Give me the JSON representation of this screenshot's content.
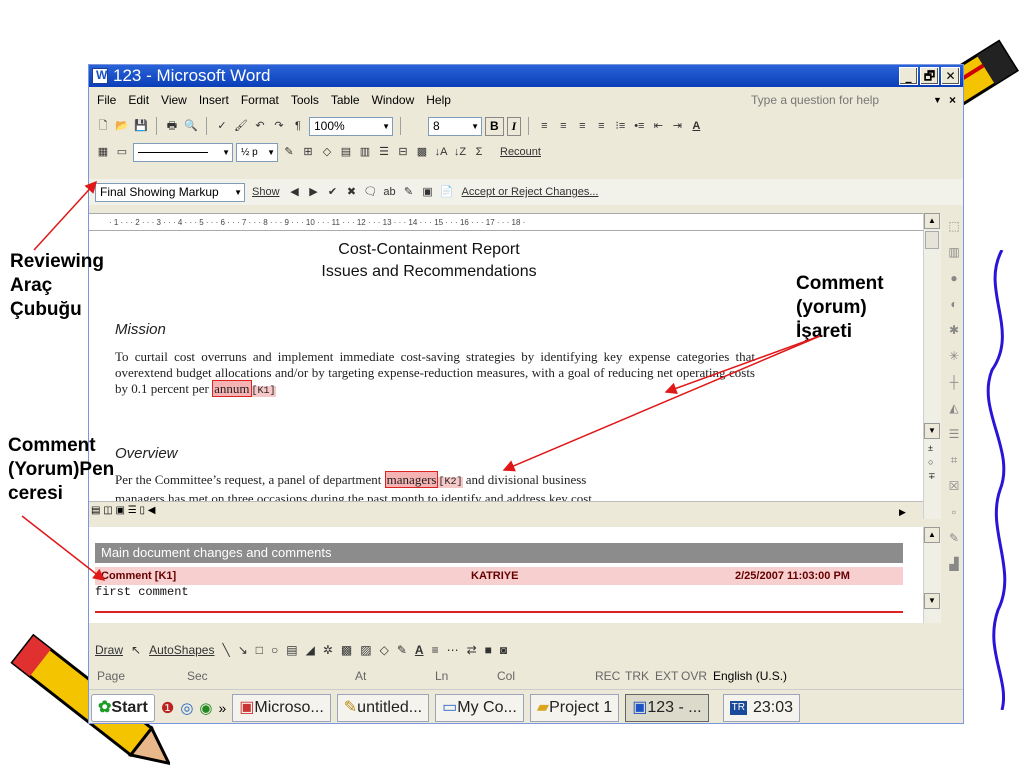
{
  "window": {
    "title": "123 - Microsoft Word",
    "controls": [
      "_",
      "🗗",
      "✕"
    ]
  },
  "menu": {
    "items": [
      "File",
      "Edit",
      "View",
      "Insert",
      "Format",
      "Tools",
      "Table",
      "Window",
      "Help"
    ],
    "help_placeholder": "Type a question for help",
    "close_doc": "×"
  },
  "toolbar1": {
    "zoom": "100%",
    "font_size": "8",
    "bold": "B",
    "italic": "I",
    "font_color_label": "A"
  },
  "toolbar2": {
    "line_weight": "½ p",
    "recount": "Recount"
  },
  "reviewing": {
    "display_mode": "Final Showing Markup",
    "show_label": "Show",
    "accept_reject": "Accept or Reject Changes..."
  },
  "ruler": {
    "ticks": "· 1 · · · 2 · · · 3 · · · 4 · · · 5 · · · 6 · · · 7 · · · 8 · · · 9 · · · 10 · · · 11 · · · 12 · · · 13 · · · 14 · · · 15 · · · 16 · · · 17 · · · 18 ·"
  },
  "document": {
    "title_line1": "Cost-Containment Report",
    "title_line2": "Issues and Recommendations",
    "mission_heading": "Mission",
    "mission_text": "To curtail cost overruns and implement immediate cost-saving strategies by identifying key expense categories that overextend budget allocations and/or by targeting expense-reduction measures, with a goal of reducing net operating costs by 0.1 percent per",
    "mission_marked": "annum",
    "mission_tag": "[K1]",
    "overview_heading": "Overview",
    "overview_text_pre": "Per the Committee’s request, a panel of department",
    "overview_marked": "managers",
    "overview_tag": "[K2]",
    "overview_text_post": "and divisional business",
    "overview_line2": "managers has met on three occasions during the past month to identify and address key cost"
  },
  "reviewing_pane": {
    "header": "Main document changes and comments",
    "comment_id": "Comment [K1]",
    "author": "KATRIYE",
    "datetime": "2/25/2007 11:03:00 PM",
    "body": "first comment"
  },
  "drawing_toolbar": {
    "draw": "Draw",
    "autoshapes": "AutoShapes"
  },
  "status_bar": {
    "page": "Page",
    "sec": "Sec",
    "at": "At",
    "ln": "Ln",
    "col": "Col",
    "rec": "REC",
    "trk": "TRK",
    "ext": "EXT",
    "ovr": "OVR",
    "language": "English (U.S.)"
  },
  "taskbar": {
    "start": "Start",
    "more": "»",
    "tasks": [
      "Microso...",
      "untitled...",
      "My Co...",
      "Project 1",
      "123 - ..."
    ],
    "tray_icon": "TR",
    "clock": "23:03"
  },
  "annotations": {
    "reviewing_toolbar": "Reviewing\nAraç\nÇubuğu",
    "comment_mark": "Comment\n(yorum)\nİşareti",
    "comment_pane": "Comment\n(Yorum)Pen\nceresi"
  },
  "colors": {
    "arrow": "#e01818",
    "title_gradient_top": "#2a63d8",
    "markup": "#f6b3b3"
  }
}
